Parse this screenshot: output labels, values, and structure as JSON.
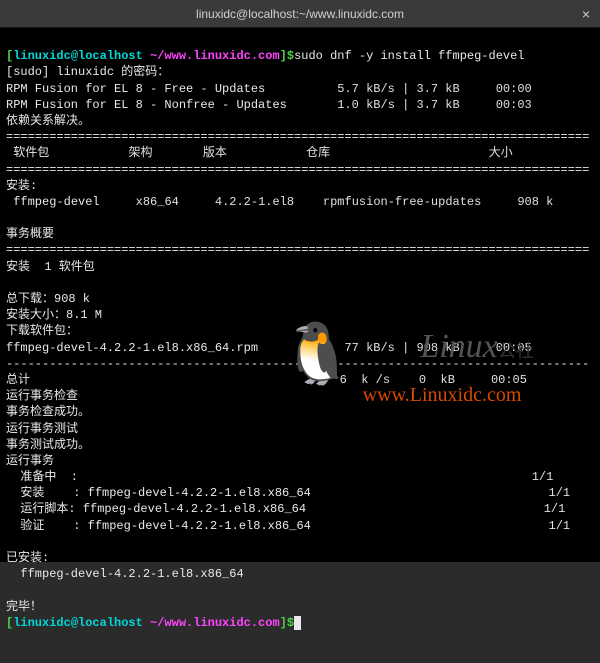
{
  "titlebar": {
    "title": "linuxidc@localhost:~/www.linuxidc.com",
    "close": "×"
  },
  "prompt": {
    "user_host": "linuxidc@localhost",
    "path": "~/www.linuxidc.com",
    "open": "[",
    "close": "]",
    "dollar": "$"
  },
  "cmd1": "sudo dnf -y install ffmpeg-devel",
  "sudo_prompt": "[sudo] linuxidc 的密码：",
  "repo1": {
    "name": "RPM Fusion for EL 8 - Free - Updates",
    "speed": "5.7 kB/s",
    "size": "3.7 kB",
    "time": "00:00"
  },
  "repo2": {
    "name": "RPM Fusion for EL 8 - Nonfree - Updates",
    "speed": "1.0 kB/s",
    "size": "3.7 kB",
    "time": "00:03"
  },
  "dep_resolve": "依赖关系解决。",
  "hline": "=================================================================================",
  "hdr": {
    "pkg": "软件包",
    "arch": "架构",
    "ver": "版本",
    "repo": "仓库",
    "size": "大小"
  },
  "install_hdr": "安装:",
  "pkg_row": {
    "name": "ffmpeg-devel",
    "arch": "x86_64",
    "ver": "4.2.2-1.el8",
    "repo": "rpmfusion-free-updates",
    "size": "908 k"
  },
  "summary_hdr": "事务概要",
  "install_count": "安装  1 软件包",
  "total_dl": "总下载：908 k",
  "install_size": "安装大小：8.1 M",
  "dl_pkg_hdr": "下载软件包：",
  "dl_row": {
    "name": "ffmpeg-devel-4.2.2-1.el8.x86_64.rpm",
    "speed": "77 kB/s",
    "size": "908 kB",
    "time": "00:05"
  },
  "dashline": "---------------------------------------------------------------------------------",
  "total_row": {
    "label": "总计",
    "speed": "6  k /s",
    "size": " 0  kB",
    "time": "00:05"
  },
  "check1": "运行事务检查",
  "check2": "事务检查成功。",
  "test1": "运行事务测试",
  "test2": "事务测试成功。",
  "run_txn": "运行事务",
  "steps": {
    "prepare": {
      "label": "准备中  :",
      "count": "1/1"
    },
    "install": {
      "label": "安装    : ffmpeg-devel-4.2.2-1.el8.x86_64",
      "count": "1/1"
    },
    "script": {
      "label": "运行脚本: ffmpeg-devel-4.2.2-1.el8.x86_64",
      "count": "1/1"
    },
    "verify": {
      "label": "验证    : ffmpeg-devel-4.2.2-1.el8.x86_64",
      "count": "1/1"
    }
  },
  "installed_hdr": "已安装:",
  "installed_pkg": "  ffmpeg-devel-4.2.2-1.el8.x86_64",
  "done": "完毕！",
  "watermark": {
    "main": "Linux",
    "sub": "公社",
    "url": "www.Linuxidc.com"
  }
}
